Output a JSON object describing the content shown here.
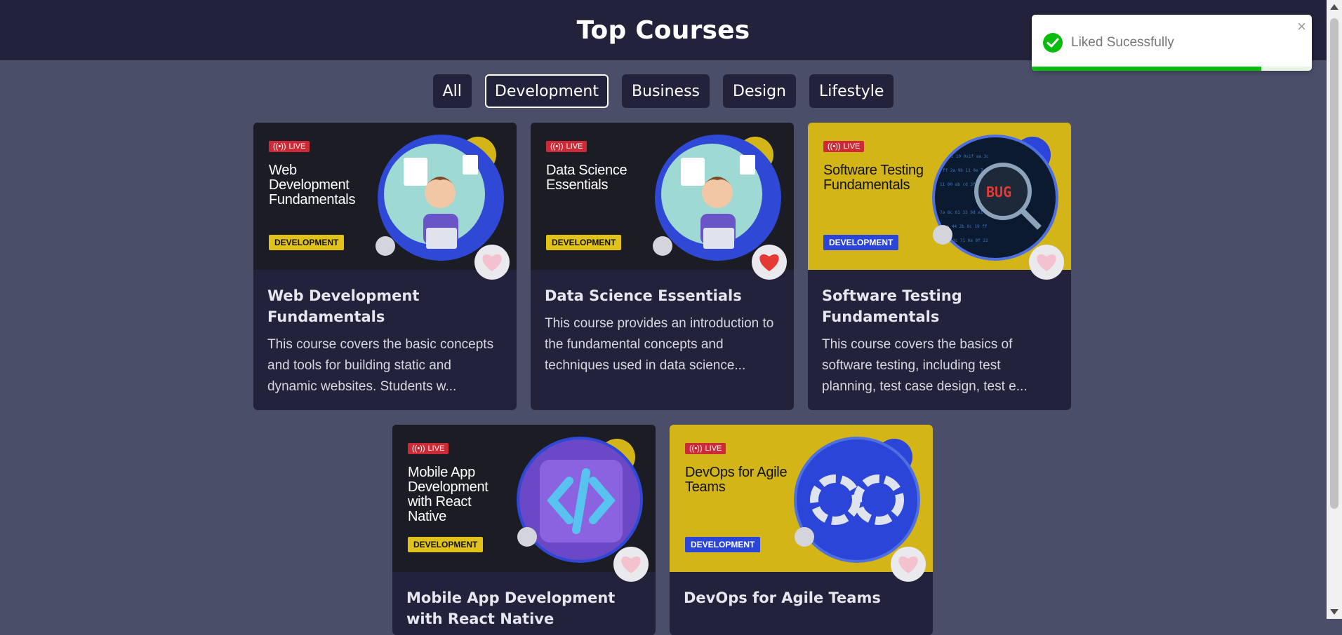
{
  "header": {
    "title": "Top Courses"
  },
  "filters": [
    {
      "label": "All",
      "active": false
    },
    {
      "label": "Development",
      "active": true
    },
    {
      "label": "Business",
      "active": false
    },
    {
      "label": "Design",
      "active": false
    },
    {
      "label": "Lifestyle",
      "active": false
    }
  ],
  "courses": [
    {
      "live_label": "LIVE",
      "thumb_title": "Web Development Fundamentals",
      "category": "DEVELOPMENT",
      "title": "Web Development Fundamentals",
      "description": "This course covers the basic concepts and tools for building static and dynamic websites. Students w...",
      "liked": false
    },
    {
      "live_label": "LIVE",
      "thumb_title": "Data Science Essentials",
      "category": "DEVELOPMENT",
      "title": "Data Science Essentials",
      "description": "This course provides an introduction to the fundamental concepts and techniques used in data science...",
      "liked": true
    },
    {
      "live_label": "LIVE",
      "thumb_title": "Software Testing Fundamentals",
      "category": "DEVELOPMENT",
      "title": "Software Testing Fundamentals",
      "description": "This course covers the basics of software testing, including test planning, test case design, test e...",
      "liked": false
    },
    {
      "live_label": "LIVE",
      "thumb_title": "Mobile App Development with React Native",
      "category": "DEVELOPMENT",
      "title": "Mobile App Development with React Native",
      "description": "",
      "liked": false
    },
    {
      "live_label": "LIVE",
      "thumb_title": "DevOps for Agile Teams",
      "category": "DEVELOPMENT",
      "title": "DevOps for Agile Teams",
      "description": "",
      "liked": false
    }
  ],
  "toast": {
    "message": "Liked Sucessfully",
    "progress": 0.82
  },
  "colors": {
    "page_bg": "#4a4e69",
    "nav_bg": "#22223b",
    "liked_heart": "#e53935",
    "unliked_heart": "#f4c2cf",
    "toast_success": "#07bc0c"
  }
}
